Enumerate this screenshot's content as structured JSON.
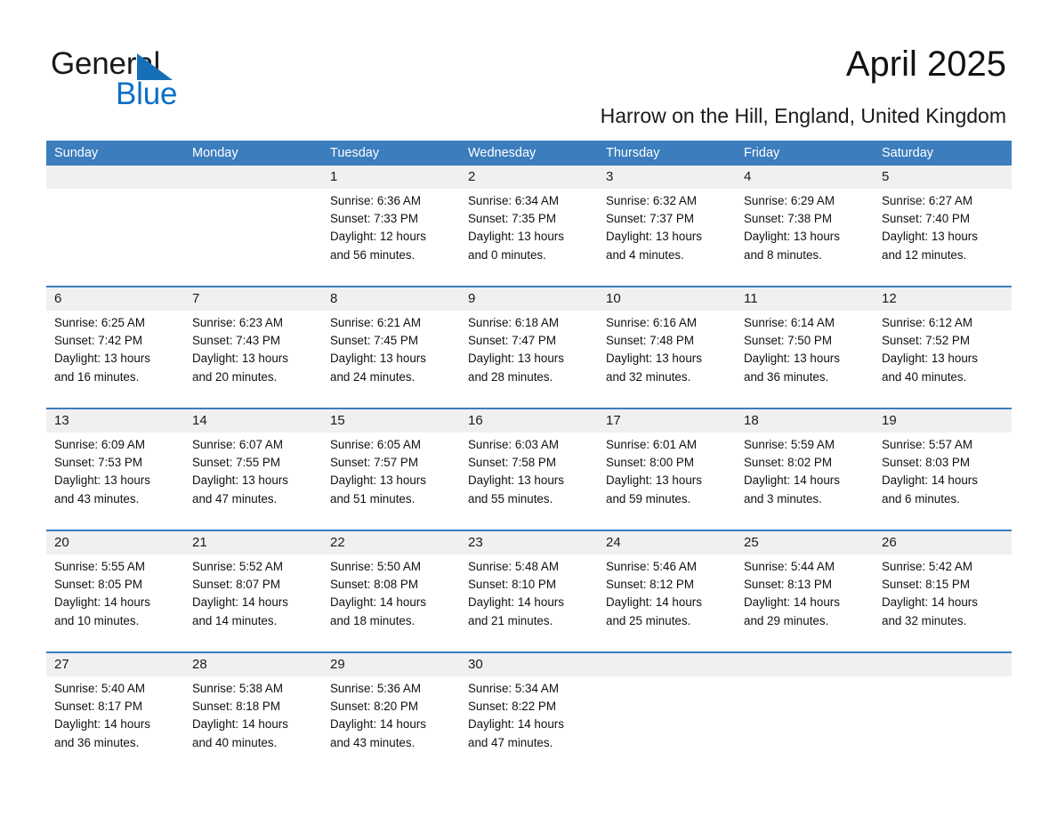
{
  "brand": {
    "name_part1": "General",
    "name_part2": "Blue",
    "triangle_color": "#1670b8",
    "blue_text_color": "#0f6fc6"
  },
  "header": {
    "title": "April 2025",
    "subtitle": "Harrow on the Hill, England, United Kingdom"
  },
  "theme": {
    "header_blue": "#3b7dbd",
    "row_band_grey": "#f0f0f0",
    "text_black": "#111111"
  },
  "calendar": {
    "weekdays": [
      "Sunday",
      "Monday",
      "Tuesday",
      "Wednesday",
      "Thursday",
      "Friday",
      "Saturday"
    ],
    "weeks": [
      [
        {
          "day": "",
          "lines": []
        },
        {
          "day": "",
          "lines": []
        },
        {
          "day": "1",
          "lines": [
            "Sunrise: 6:36 AM",
            "Sunset: 7:33 PM",
            "Daylight: 12 hours",
            "and 56 minutes."
          ]
        },
        {
          "day": "2",
          "lines": [
            "Sunrise: 6:34 AM",
            "Sunset: 7:35 PM",
            "Daylight: 13 hours",
            "and 0 minutes."
          ]
        },
        {
          "day": "3",
          "lines": [
            "Sunrise: 6:32 AM",
            "Sunset: 7:37 PM",
            "Daylight: 13 hours",
            "and 4 minutes."
          ]
        },
        {
          "day": "4",
          "lines": [
            "Sunrise: 6:29 AM",
            "Sunset: 7:38 PM",
            "Daylight: 13 hours",
            "and 8 minutes."
          ]
        },
        {
          "day": "5",
          "lines": [
            "Sunrise: 6:27 AM",
            "Sunset: 7:40 PM",
            "Daylight: 13 hours",
            "and 12 minutes."
          ]
        }
      ],
      [
        {
          "day": "6",
          "lines": [
            "Sunrise: 6:25 AM",
            "Sunset: 7:42 PM",
            "Daylight: 13 hours",
            "and 16 minutes."
          ]
        },
        {
          "day": "7",
          "lines": [
            "Sunrise: 6:23 AM",
            "Sunset: 7:43 PM",
            "Daylight: 13 hours",
            "and 20 minutes."
          ]
        },
        {
          "day": "8",
          "lines": [
            "Sunrise: 6:21 AM",
            "Sunset: 7:45 PM",
            "Daylight: 13 hours",
            "and 24 minutes."
          ]
        },
        {
          "day": "9",
          "lines": [
            "Sunrise: 6:18 AM",
            "Sunset: 7:47 PM",
            "Daylight: 13 hours",
            "and 28 minutes."
          ]
        },
        {
          "day": "10",
          "lines": [
            "Sunrise: 6:16 AM",
            "Sunset: 7:48 PM",
            "Daylight: 13 hours",
            "and 32 minutes."
          ]
        },
        {
          "day": "11",
          "lines": [
            "Sunrise: 6:14 AM",
            "Sunset: 7:50 PM",
            "Daylight: 13 hours",
            "and 36 minutes."
          ]
        },
        {
          "day": "12",
          "lines": [
            "Sunrise: 6:12 AM",
            "Sunset: 7:52 PM",
            "Daylight: 13 hours",
            "and 40 minutes."
          ]
        }
      ],
      [
        {
          "day": "13",
          "lines": [
            "Sunrise: 6:09 AM",
            "Sunset: 7:53 PM",
            "Daylight: 13 hours",
            "and 43 minutes."
          ]
        },
        {
          "day": "14",
          "lines": [
            "Sunrise: 6:07 AM",
            "Sunset: 7:55 PM",
            "Daylight: 13 hours",
            "and 47 minutes."
          ]
        },
        {
          "day": "15",
          "lines": [
            "Sunrise: 6:05 AM",
            "Sunset: 7:57 PM",
            "Daylight: 13 hours",
            "and 51 minutes."
          ]
        },
        {
          "day": "16",
          "lines": [
            "Sunrise: 6:03 AM",
            "Sunset: 7:58 PM",
            "Daylight: 13 hours",
            "and 55 minutes."
          ]
        },
        {
          "day": "17",
          "lines": [
            "Sunrise: 6:01 AM",
            "Sunset: 8:00 PM",
            "Daylight: 13 hours",
            "and 59 minutes."
          ]
        },
        {
          "day": "18",
          "lines": [
            "Sunrise: 5:59 AM",
            "Sunset: 8:02 PM",
            "Daylight: 14 hours",
            "and 3 minutes."
          ]
        },
        {
          "day": "19",
          "lines": [
            "Sunrise: 5:57 AM",
            "Sunset: 8:03 PM",
            "Daylight: 14 hours",
            "and 6 minutes."
          ]
        }
      ],
      [
        {
          "day": "20",
          "lines": [
            "Sunrise: 5:55 AM",
            "Sunset: 8:05 PM",
            "Daylight: 14 hours",
            "and 10 minutes."
          ]
        },
        {
          "day": "21",
          "lines": [
            "Sunrise: 5:52 AM",
            "Sunset: 8:07 PM",
            "Daylight: 14 hours",
            "and 14 minutes."
          ]
        },
        {
          "day": "22",
          "lines": [
            "Sunrise: 5:50 AM",
            "Sunset: 8:08 PM",
            "Daylight: 14 hours",
            "and 18 minutes."
          ]
        },
        {
          "day": "23",
          "lines": [
            "Sunrise: 5:48 AM",
            "Sunset: 8:10 PM",
            "Daylight: 14 hours",
            "and 21 minutes."
          ]
        },
        {
          "day": "24",
          "lines": [
            "Sunrise: 5:46 AM",
            "Sunset: 8:12 PM",
            "Daylight: 14 hours",
            "and 25 minutes."
          ]
        },
        {
          "day": "25",
          "lines": [
            "Sunrise: 5:44 AM",
            "Sunset: 8:13 PM",
            "Daylight: 14 hours",
            "and 29 minutes."
          ]
        },
        {
          "day": "26",
          "lines": [
            "Sunrise: 5:42 AM",
            "Sunset: 8:15 PM",
            "Daylight: 14 hours",
            "and 32 minutes."
          ]
        }
      ],
      [
        {
          "day": "27",
          "lines": [
            "Sunrise: 5:40 AM",
            "Sunset: 8:17 PM",
            "Daylight: 14 hours",
            "and 36 minutes."
          ]
        },
        {
          "day": "28",
          "lines": [
            "Sunrise: 5:38 AM",
            "Sunset: 8:18 PM",
            "Daylight: 14 hours",
            "and 40 minutes."
          ]
        },
        {
          "day": "29",
          "lines": [
            "Sunrise: 5:36 AM",
            "Sunset: 8:20 PM",
            "Daylight: 14 hours",
            "and 43 minutes."
          ]
        },
        {
          "day": "30",
          "lines": [
            "Sunrise: 5:34 AM",
            "Sunset: 8:22 PM",
            "Daylight: 14 hours",
            "and 47 minutes."
          ]
        },
        {
          "day": "",
          "lines": []
        },
        {
          "day": "",
          "lines": []
        },
        {
          "day": "",
          "lines": []
        }
      ]
    ]
  }
}
